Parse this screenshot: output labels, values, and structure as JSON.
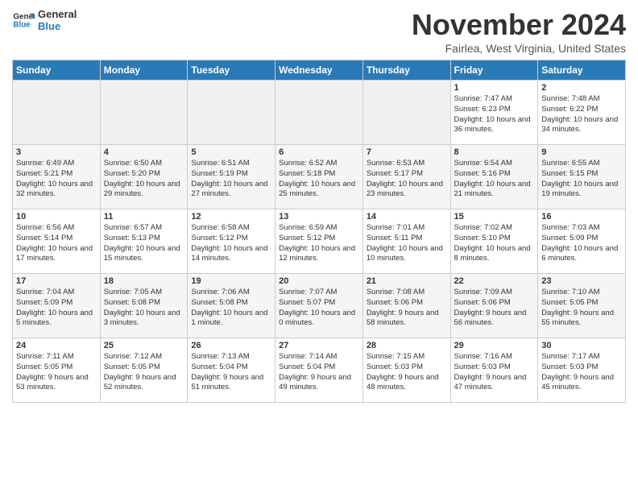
{
  "header": {
    "logo_general": "General",
    "logo_blue": "Blue",
    "month": "November 2024",
    "location": "Fairlea, West Virginia, United States"
  },
  "days_of_week": [
    "Sunday",
    "Monday",
    "Tuesday",
    "Wednesday",
    "Thursday",
    "Friday",
    "Saturday"
  ],
  "weeks": [
    [
      {
        "day": "",
        "info": ""
      },
      {
        "day": "",
        "info": ""
      },
      {
        "day": "",
        "info": ""
      },
      {
        "day": "",
        "info": ""
      },
      {
        "day": "",
        "info": ""
      },
      {
        "day": "1",
        "info": "Sunrise: 7:47 AM\nSunset: 6:23 PM\nDaylight: 10 hours and 36 minutes."
      },
      {
        "day": "2",
        "info": "Sunrise: 7:48 AM\nSunset: 6:22 PM\nDaylight: 10 hours and 34 minutes."
      }
    ],
    [
      {
        "day": "3",
        "info": "Sunrise: 6:49 AM\nSunset: 5:21 PM\nDaylight: 10 hours and 32 minutes."
      },
      {
        "day": "4",
        "info": "Sunrise: 6:50 AM\nSunset: 5:20 PM\nDaylight: 10 hours and 29 minutes."
      },
      {
        "day": "5",
        "info": "Sunrise: 6:51 AM\nSunset: 5:19 PM\nDaylight: 10 hours and 27 minutes."
      },
      {
        "day": "6",
        "info": "Sunrise: 6:52 AM\nSunset: 5:18 PM\nDaylight: 10 hours and 25 minutes."
      },
      {
        "day": "7",
        "info": "Sunrise: 6:53 AM\nSunset: 5:17 PM\nDaylight: 10 hours and 23 minutes."
      },
      {
        "day": "8",
        "info": "Sunrise: 6:54 AM\nSunset: 5:16 PM\nDaylight: 10 hours and 21 minutes."
      },
      {
        "day": "9",
        "info": "Sunrise: 6:55 AM\nSunset: 5:15 PM\nDaylight: 10 hours and 19 minutes."
      }
    ],
    [
      {
        "day": "10",
        "info": "Sunrise: 6:56 AM\nSunset: 5:14 PM\nDaylight: 10 hours and 17 minutes."
      },
      {
        "day": "11",
        "info": "Sunrise: 6:57 AM\nSunset: 5:13 PM\nDaylight: 10 hours and 15 minutes."
      },
      {
        "day": "12",
        "info": "Sunrise: 6:58 AM\nSunset: 5:12 PM\nDaylight: 10 hours and 14 minutes."
      },
      {
        "day": "13",
        "info": "Sunrise: 6:59 AM\nSunset: 5:12 PM\nDaylight: 10 hours and 12 minutes."
      },
      {
        "day": "14",
        "info": "Sunrise: 7:01 AM\nSunset: 5:11 PM\nDaylight: 10 hours and 10 minutes."
      },
      {
        "day": "15",
        "info": "Sunrise: 7:02 AM\nSunset: 5:10 PM\nDaylight: 10 hours and 8 minutes."
      },
      {
        "day": "16",
        "info": "Sunrise: 7:03 AM\nSunset: 5:09 PM\nDaylight: 10 hours and 6 minutes."
      }
    ],
    [
      {
        "day": "17",
        "info": "Sunrise: 7:04 AM\nSunset: 5:09 PM\nDaylight: 10 hours and 5 minutes."
      },
      {
        "day": "18",
        "info": "Sunrise: 7:05 AM\nSunset: 5:08 PM\nDaylight: 10 hours and 3 minutes."
      },
      {
        "day": "19",
        "info": "Sunrise: 7:06 AM\nSunset: 5:08 PM\nDaylight: 10 hours and 1 minute."
      },
      {
        "day": "20",
        "info": "Sunrise: 7:07 AM\nSunset: 5:07 PM\nDaylight: 10 hours and 0 minutes."
      },
      {
        "day": "21",
        "info": "Sunrise: 7:08 AM\nSunset: 5:06 PM\nDaylight: 9 hours and 58 minutes."
      },
      {
        "day": "22",
        "info": "Sunrise: 7:09 AM\nSunset: 5:06 PM\nDaylight: 9 hours and 56 minutes."
      },
      {
        "day": "23",
        "info": "Sunrise: 7:10 AM\nSunset: 5:05 PM\nDaylight: 9 hours and 55 minutes."
      }
    ],
    [
      {
        "day": "24",
        "info": "Sunrise: 7:11 AM\nSunset: 5:05 PM\nDaylight: 9 hours and 53 minutes."
      },
      {
        "day": "25",
        "info": "Sunrise: 7:12 AM\nSunset: 5:05 PM\nDaylight: 9 hours and 52 minutes."
      },
      {
        "day": "26",
        "info": "Sunrise: 7:13 AM\nSunset: 5:04 PM\nDaylight: 9 hours and 51 minutes."
      },
      {
        "day": "27",
        "info": "Sunrise: 7:14 AM\nSunset: 5:04 PM\nDaylight: 9 hours and 49 minutes."
      },
      {
        "day": "28",
        "info": "Sunrise: 7:15 AM\nSunset: 5:03 PM\nDaylight: 9 hours and 48 minutes."
      },
      {
        "day": "29",
        "info": "Sunrise: 7:16 AM\nSunset: 5:03 PM\nDaylight: 9 hours and 47 minutes."
      },
      {
        "day": "30",
        "info": "Sunrise: 7:17 AM\nSunset: 5:03 PM\nDaylight: 9 hours and 45 minutes."
      }
    ]
  ]
}
